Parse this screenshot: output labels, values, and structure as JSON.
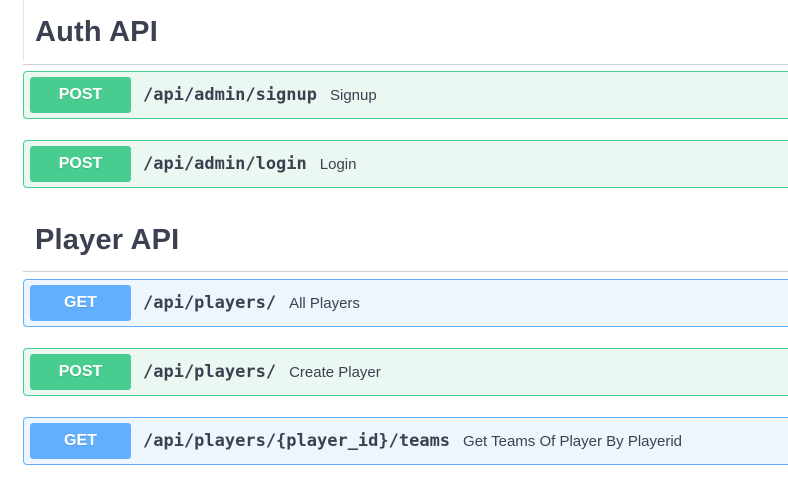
{
  "sections": [
    {
      "title": "Auth API",
      "operations": [
        {
          "method": "POST",
          "path": "/api/admin/signup",
          "summary": "Signup"
        },
        {
          "method": "POST",
          "path": "/api/admin/login",
          "summary": "Login"
        }
      ]
    },
    {
      "title": "Player API",
      "operations": [
        {
          "method": "GET",
          "path": "/api/players/",
          "summary": "All Players"
        },
        {
          "method": "POST",
          "path": "/api/players/",
          "summary": "Create Player"
        },
        {
          "method": "GET",
          "path": "/api/players/{player_id}/teams",
          "summary": "Get Teams Of Player By Playerid"
        }
      ]
    }
  ],
  "colors": {
    "post_accent": "#49cc90",
    "post_background": "#ebf8f1",
    "get_accent": "#61affe",
    "get_background": "#eef5fc",
    "text": "#3b4151"
  }
}
